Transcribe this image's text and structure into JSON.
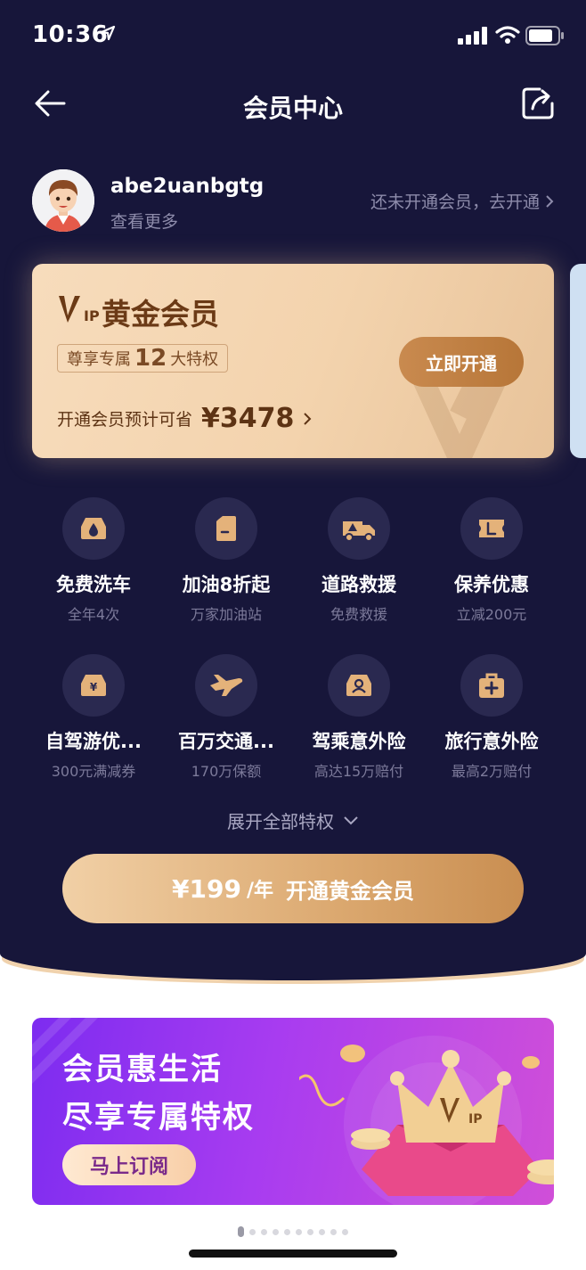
{
  "status_bar": {
    "time": "10:36"
  },
  "nav": {
    "title": "会员中心"
  },
  "user": {
    "name": "abe2uanbgtg",
    "see_more": "查看更多",
    "join_link": "还未开通会员，去开通"
  },
  "vip_card": {
    "logo_text": "IP",
    "title": "黄金会员",
    "badge_prefix": "尊享专属",
    "badge_number": "12",
    "badge_suffix": "大特权",
    "open_button": "立即开通",
    "save_label": "开通会员预计可省",
    "save_amount": "¥3478"
  },
  "benefits": [
    {
      "title": "免费洗车",
      "sub": "全年4次",
      "icon": "car-wash-icon"
    },
    {
      "title": "加油8折起",
      "sub": "万家加油站",
      "icon": "fuel-icon"
    },
    {
      "title": "道路救援",
      "sub": "免费救援",
      "icon": "rescue-truck-icon"
    },
    {
      "title": "保养优惠",
      "sub": "立减200元",
      "icon": "maintenance-ticket-icon"
    },
    {
      "title": "自驾游优...",
      "sub": "300元满减券",
      "icon": "car-coupon-icon"
    },
    {
      "title": "百万交通...",
      "sub": "170万保额",
      "icon": "plane-icon"
    },
    {
      "title": "驾乘意外险",
      "sub": "高达15万赔付",
      "icon": "driver-insurance-icon"
    },
    {
      "title": "旅行意外险",
      "sub": "最高2万赔付",
      "icon": "medical-kit-icon"
    }
  ],
  "expand_all": "展开全部特权",
  "cta": {
    "price": "¥199",
    "unit": "/年",
    "label": "开通黄金会员"
  },
  "banner": {
    "line1": "会员惠生活",
    "line2": "尽享专属特权",
    "button": "马上订阅",
    "art_logo": "IP"
  },
  "pager": {
    "count": 10,
    "active": 0
  },
  "colors": {
    "background_dark": "#17163a",
    "gold": "#d9a56c",
    "card_gold": "#f5d8b4",
    "banner_purple": "#a83cf0"
  }
}
